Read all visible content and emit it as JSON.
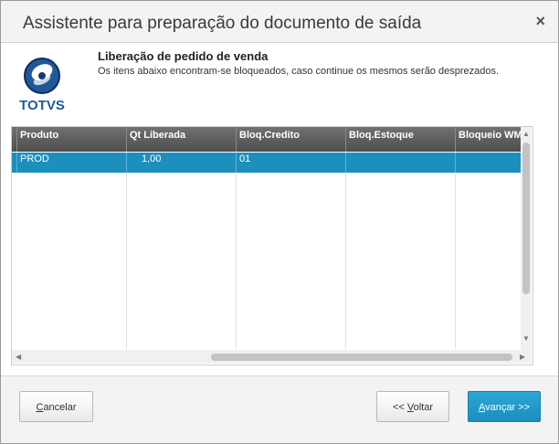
{
  "window": {
    "title": "Assistente para preparação do documento de saída"
  },
  "header": {
    "logo_text": "TOTVS",
    "heading": "Liberação de pedido de venda",
    "description": "Os itens abaixo encontram-se bloqueados, caso continue os mesmos serão desprezados."
  },
  "grid": {
    "columns": [
      "Produto",
      "Qt Liberada",
      "Bloq.Credito",
      "Bloq.Estoque",
      "Bloqueio WMS"
    ],
    "rows": [
      {
        "produto": "PROD",
        "qt_liberada": "1,00",
        "bloq_credito": "01",
        "bloq_estoque": "",
        "bloqueio_wms": ""
      }
    ]
  },
  "footer": {
    "cancel": {
      "prefix": "",
      "accel": "C",
      "rest": "ancelar"
    },
    "back": {
      "prefix": "<< ",
      "accel": "V",
      "rest": "oltar"
    },
    "next": {
      "prefix": "",
      "accel": "A",
      "rest": "vançar >>"
    }
  },
  "colors": {
    "accent": "#1d8fbc",
    "header_bg": "#5e5e5e",
    "title_bg": "#f3f3f3"
  }
}
